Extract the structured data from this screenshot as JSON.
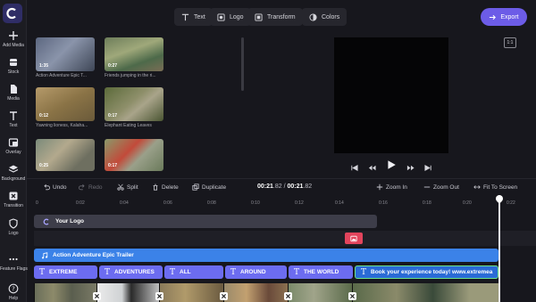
{
  "toolbar": {
    "text_label": "Text",
    "logo_label": "Logo",
    "transform_label": "Transform",
    "colors_label": "Colors",
    "export_label": "Export",
    "ratio_label": "1:1"
  },
  "sidebar": {
    "items": [
      {
        "label": "Add Media",
        "icon": "plus-icon"
      },
      {
        "label": "Stock",
        "icon": "stock-icon"
      },
      {
        "label": "Media",
        "icon": "media-icon"
      },
      {
        "label": "Text",
        "icon": "text-icon"
      },
      {
        "label": "Overlay",
        "icon": "overlay-icon"
      },
      {
        "label": "Background",
        "icon": "layers-icon"
      },
      {
        "label": "Transition",
        "icon": "transition-icon"
      },
      {
        "label": "Logo",
        "icon": "shield-icon"
      },
      {
        "label": "Feature Flags",
        "icon": "more-icon"
      },
      {
        "label": "Help",
        "icon": "help-icon"
      }
    ]
  },
  "media": {
    "items": [
      {
        "duration": "1:35",
        "caption": "Action Adventure Epic T..."
      },
      {
        "duration": "0:27",
        "caption": "Friends jumping in the ri..."
      },
      {
        "duration": "0:12",
        "caption": "Yawning lioness, Kalaha..."
      },
      {
        "duration": "0:17",
        "caption": "Elephant Eating Leaves"
      },
      {
        "duration": "0:25",
        "caption": ""
      },
      {
        "duration": "0:17",
        "caption": ""
      }
    ]
  },
  "timeline": {
    "undo_label": "Undo",
    "redo_label": "Redo",
    "split_label": "Split",
    "delete_label": "Delete",
    "duplicate_label": "Duplicate",
    "time_current": "00:21",
    "time_current_ms": ".82",
    "time_sep": " / ",
    "time_total": "00:21",
    "time_total_ms": ".82",
    "zoom_in_label": "Zoom In",
    "zoom_out_label": "Zoom Out",
    "fit_label": "Fit To Screen",
    "ticks": [
      "0",
      "0:02",
      "0:04",
      "0:06",
      "0:08",
      "0:10",
      "0:12",
      "0:14",
      "0:16",
      "0:18",
      "0:20",
      "0:22"
    ],
    "logo_track_label": "Your Logo",
    "audio_track_label": "Action Adventure Epic Trailer",
    "text_clips": [
      "EXTREME",
      "ADVENTURES",
      "ALL",
      "AROUND",
      "THE WORLD",
      "Book your experience today! www.extremea"
    ]
  },
  "colors": {
    "accent": "#6c5ce7",
    "audio": "#3b82e8",
    "text_clip": "#6c6cf0",
    "sticker": "#e2445c"
  }
}
